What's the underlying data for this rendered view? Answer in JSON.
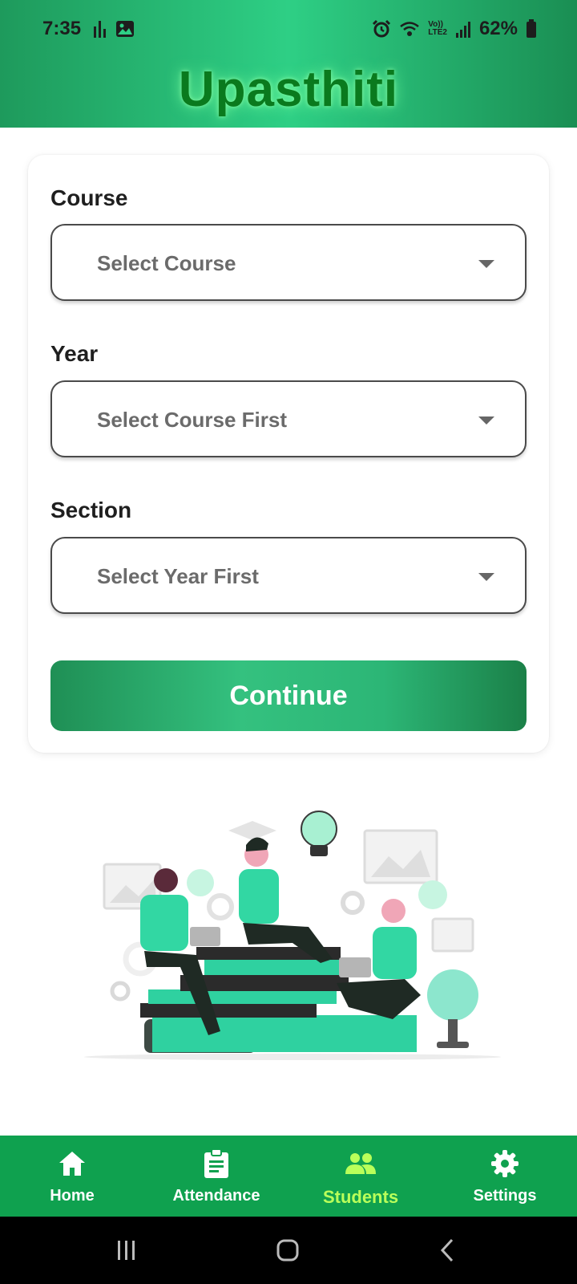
{
  "status_bar": {
    "time": "7:35",
    "battery": "62%",
    "network_label_top": "Vo))",
    "network_label_bottom": "LTE2"
  },
  "app": {
    "title": "Upasthiti"
  },
  "form": {
    "course": {
      "label": "Course",
      "placeholder": "Select Course"
    },
    "year": {
      "label": "Year",
      "placeholder": "Select Course First"
    },
    "section": {
      "label": "Section",
      "placeholder": "Select Year First"
    },
    "continue_label": "Continue"
  },
  "bottom_nav": {
    "items": [
      {
        "label": "Home",
        "icon": "home-icon"
      },
      {
        "label": "Attendance",
        "icon": "clipboard-icon"
      },
      {
        "label": "Students",
        "icon": "people-icon",
        "active": true
      },
      {
        "label": "Settings",
        "icon": "gear-icon"
      }
    ]
  },
  "colors": {
    "brand_green": "#0fa14f",
    "header_gradient_mid": "#2ecf85",
    "title_green": "#0a7a1e",
    "active_nav": "#b9ff5a"
  }
}
